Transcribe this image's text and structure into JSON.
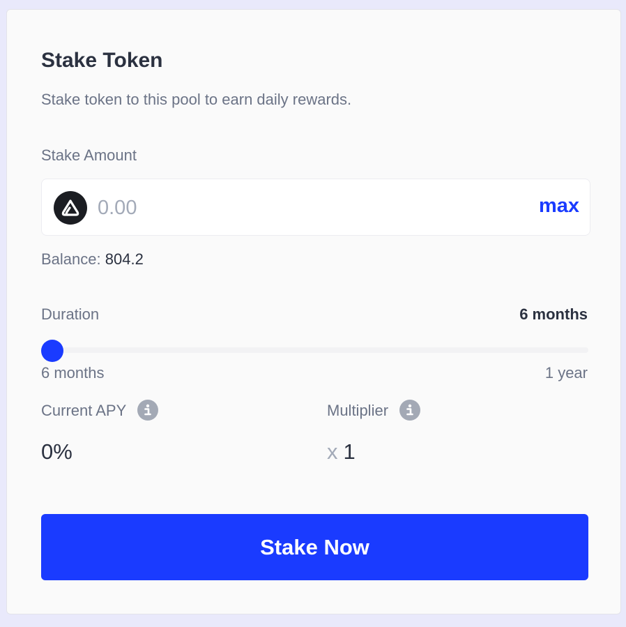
{
  "stake_card": {
    "title": "Stake Token",
    "subtitle": "Stake token to this pool to earn daily rewards.",
    "amount": {
      "label": "Stake Amount",
      "value": "",
      "placeholder": "0.00",
      "max_label": "max",
      "token_icon": "token-logo-icon"
    },
    "balance": {
      "label": "Balance:",
      "value": "804.2"
    },
    "duration": {
      "label": "Duration",
      "selected": "6 months",
      "min_label": "6 months",
      "max_label": "1 year",
      "slider_level": 0
    },
    "apy": {
      "label": "Current APY",
      "value": "0%",
      "icon": "info-icon"
    },
    "multiplier": {
      "label": "Multiplier",
      "prefix": "x",
      "value": "1",
      "icon": "info-icon"
    },
    "submit_label": "Stake Now"
  },
  "colors": {
    "accent": "#1a3bff",
    "text_primary": "#2b3140",
    "text_muted": "#6b7386",
    "placeholder": "#a3aab8",
    "page_background": "#e9e9fb",
    "card_background": "#fafafa"
  }
}
